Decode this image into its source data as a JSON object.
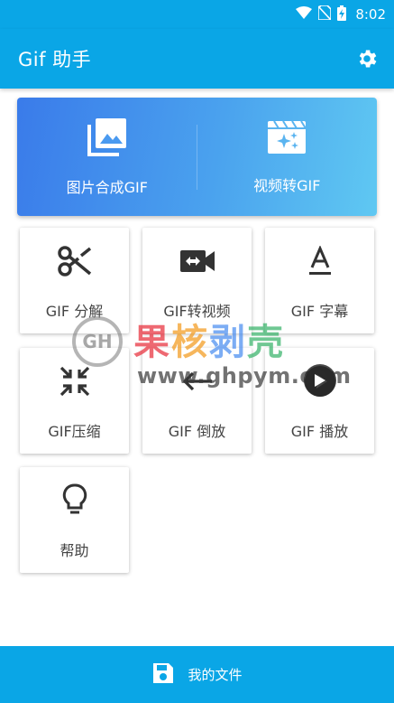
{
  "status_bar": {
    "time": "8:02"
  },
  "app_bar": {
    "title": "Gif 助手",
    "settings_icon": "gear-icon"
  },
  "hero": {
    "items": [
      {
        "label": "图片合成GIF",
        "icon": "photo-library-icon"
      },
      {
        "label": "视频转GIF",
        "icon": "movie-sparkle-icon"
      }
    ]
  },
  "grid": {
    "items": [
      {
        "label": "GIF 分解",
        "icon": "scissors-icon"
      },
      {
        "label": "GIF转视频",
        "icon": "video-convert-icon"
      },
      {
        "label": "GIF 字幕",
        "icon": "text-format-icon"
      },
      {
        "label": "GIF压缩",
        "icon": "compress-icon"
      },
      {
        "label": "GIF 倒放",
        "icon": "back-arrow-icon"
      },
      {
        "label": "GIF 播放",
        "icon": "play-icon"
      },
      {
        "label": "帮助",
        "icon": "lightbulb-icon"
      }
    ]
  },
  "bottom_bar": {
    "label": "我的文件",
    "icon": "save-icon"
  },
  "watermark": {
    "chars": [
      "果",
      "核",
      "剥",
      "壳"
    ],
    "url": "www.ghpym.com",
    "logo_text": "GH"
  },
  "colors": {
    "primary": "#0aa6e6",
    "hero_start": "#3a7bea",
    "hero_end": "#5fc8f2",
    "icon_dark": "#333333"
  }
}
